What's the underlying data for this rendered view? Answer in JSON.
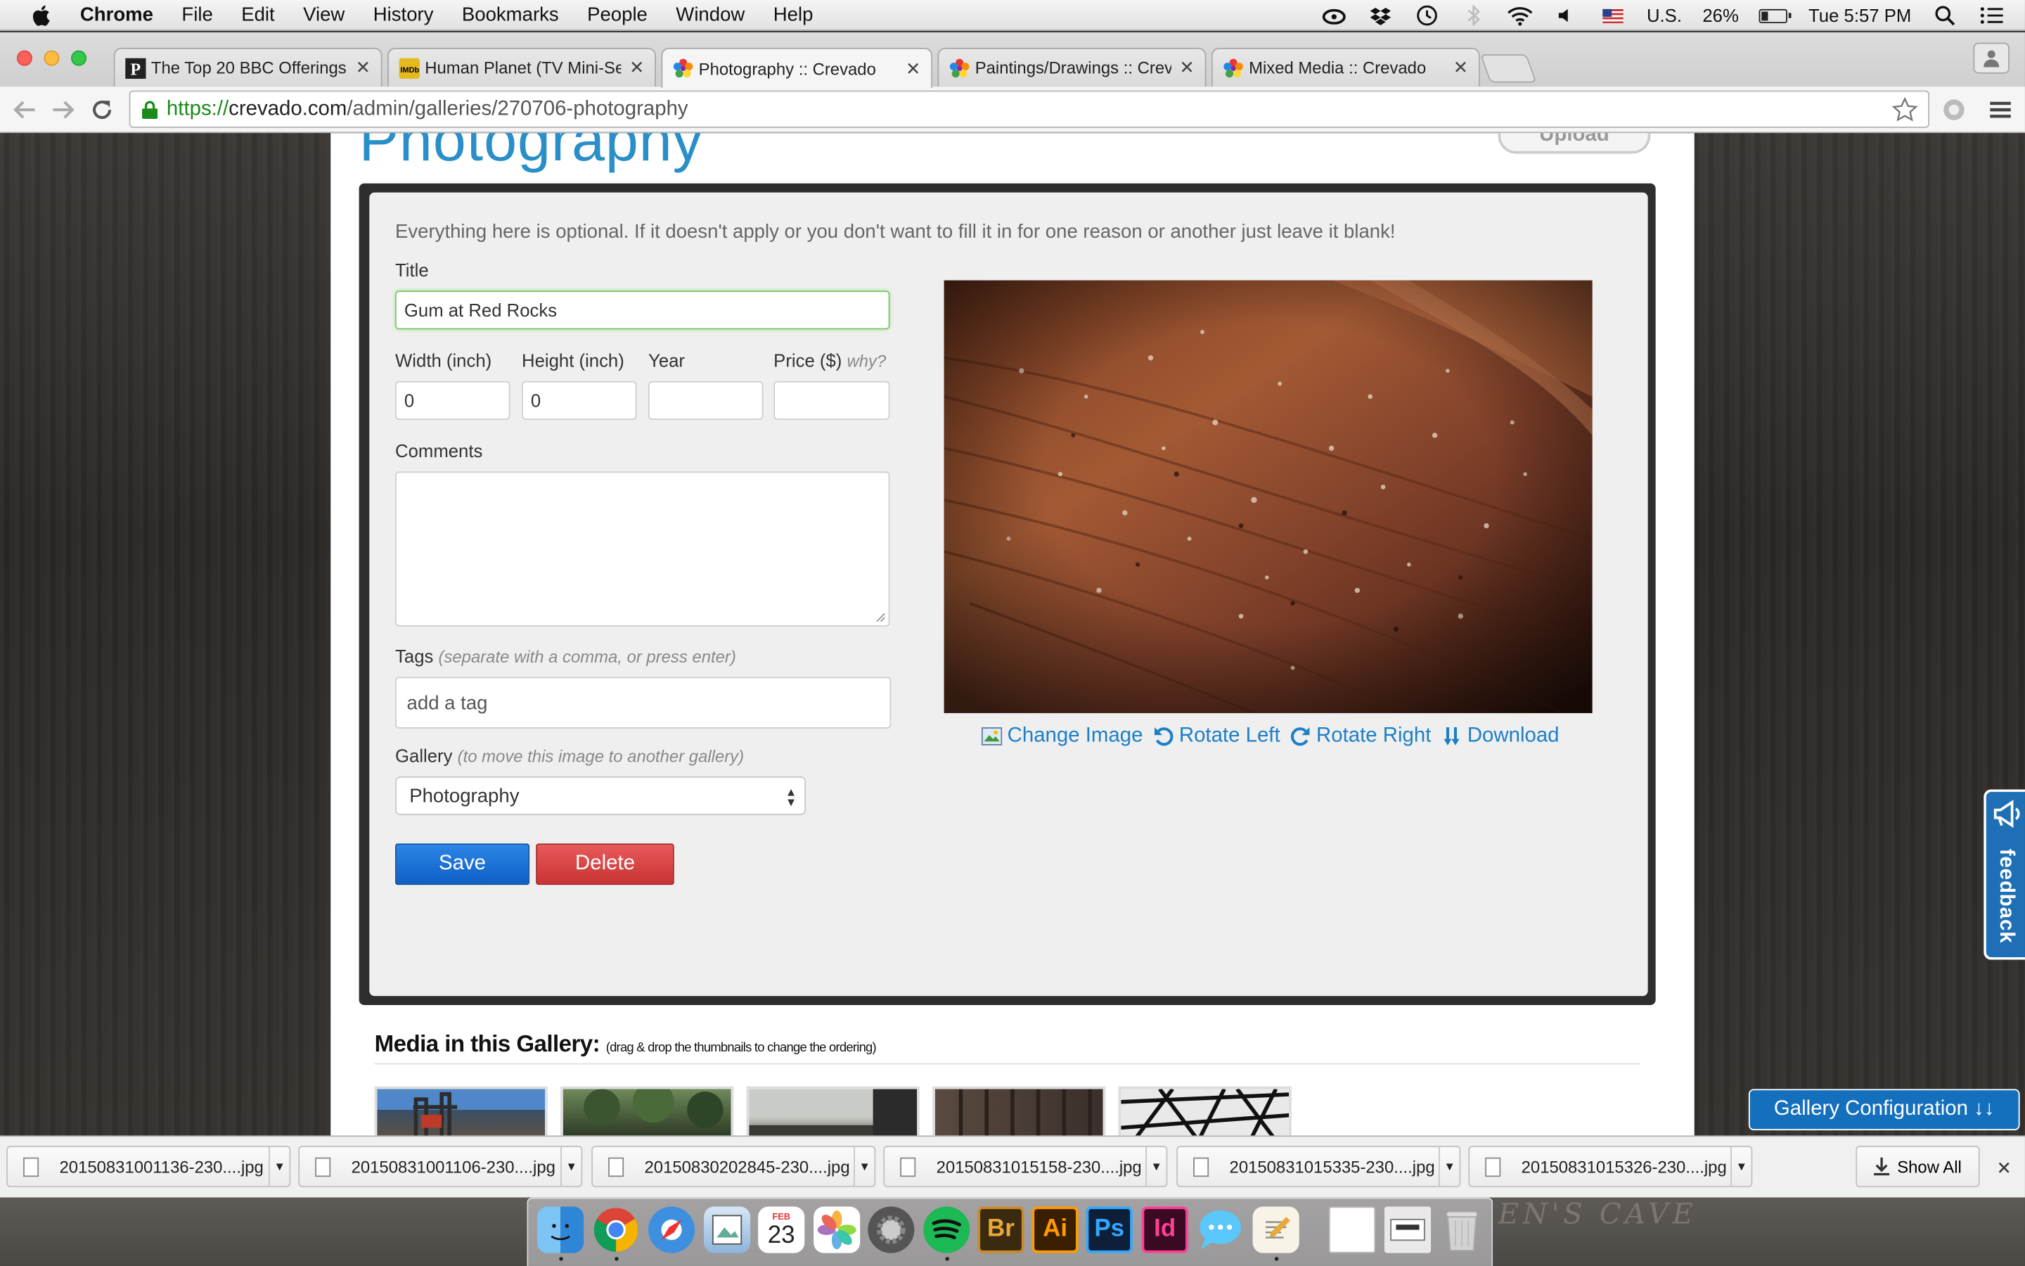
{
  "menubar": {
    "app": "Chrome",
    "items": [
      "File",
      "Edit",
      "View",
      "History",
      "Bookmarks",
      "People",
      "Window",
      "Help"
    ],
    "input_source": "U.S.",
    "battery": "26%",
    "clock": "Tue 5:57 PM",
    "icons": [
      "creative-cloud-icon",
      "dropbox-icon",
      "time-machine-icon",
      "bluetooth-icon",
      "wifi-icon",
      "volume-icon",
      "spotlight-icon",
      "notification-center-icon"
    ]
  },
  "tabs": [
    {
      "title": "The Top 20 BBC Offerings",
      "favicon": "p-icon",
      "active": false
    },
    {
      "title": "Human Planet (TV Mini-Ser",
      "favicon": "imdb-icon",
      "active": false
    },
    {
      "title": "Photography :: Crevado",
      "favicon": "crevado-icon",
      "active": true
    },
    {
      "title": "Paintings/Drawings :: Crev",
      "favicon": "crevado-icon",
      "active": false
    },
    {
      "title": "Mixed Media :: Crevado",
      "favicon": "crevado-icon",
      "active": false
    }
  ],
  "omnibox": {
    "url_scheme": "https://",
    "url_host": "crevado.com",
    "url_path": "/admin/galleries/270706-photography"
  },
  "page": {
    "title": "Photography",
    "upload_label": "Upload",
    "intro": "Everything here is optional. If it doesn't apply or you don't want to fill it in for one reason or another just leave it blank!",
    "title_label": "Title",
    "title_value": "Gum at Red Rocks",
    "width_label": "Width (inch)",
    "width_value": "0",
    "height_label": "Height (inch)",
    "height_value": "0",
    "year_label": "Year",
    "year_value": "",
    "price_label": "Price ($)",
    "price_note": "why?",
    "price_value": "",
    "comments_label": "Comments",
    "tags_label": "Tags",
    "tags_note": "(separate with a comma, or press enter)",
    "tags_placeholder": "add a tag",
    "gallery_label": "Gallery",
    "gallery_note": "(to move this image to another gallery)",
    "gallery_value": "Photography",
    "save_label": "Save",
    "delete_label": "Delete",
    "image_actions": [
      {
        "label": "Change Image",
        "icon": "image-icon"
      },
      {
        "label": "Rotate Left",
        "icon": "rotate-left-icon"
      },
      {
        "label": "Rotate Right",
        "icon": "rotate-right-icon"
      },
      {
        "label": "Download",
        "icon": "download-icon"
      }
    ],
    "media_title": "Media in this Gallery:",
    "media_note": "(drag & drop the thumbnails to change the ordering)",
    "feedback_label": "feedback",
    "gallery_config_label": "Gallery Configuration ↓↓"
  },
  "downloads": {
    "items": [
      "20150831001136-230....jpg",
      "20150831001106-230....jpg",
      "20150830202845-230....jpg",
      "20150831015158-230....jpg",
      "20150831015335-230....jpg",
      "20150831015326-230....jpg"
    ],
    "show_all_label": "Show All"
  },
  "dock": {
    "apps": [
      "Finder",
      "Chrome",
      "Safari",
      "Preview",
      "Calendar",
      "Photos",
      "System Preferences",
      "Spotify",
      "Br",
      "Ai",
      "Ps",
      "Id",
      "Messages",
      "TextEdit",
      "Document",
      "Downloads",
      "Trash"
    ],
    "calendar_month": "FEB",
    "calendar_day": "23",
    "background_text": "EN'S CAVE"
  },
  "colors": {
    "accent_blue": "#2a8fc9",
    "save_blue": "#1e6fd0",
    "delete_red": "#d94444",
    "focus_green": "#7dc96a",
    "link_blue": "#1d7fc6"
  }
}
